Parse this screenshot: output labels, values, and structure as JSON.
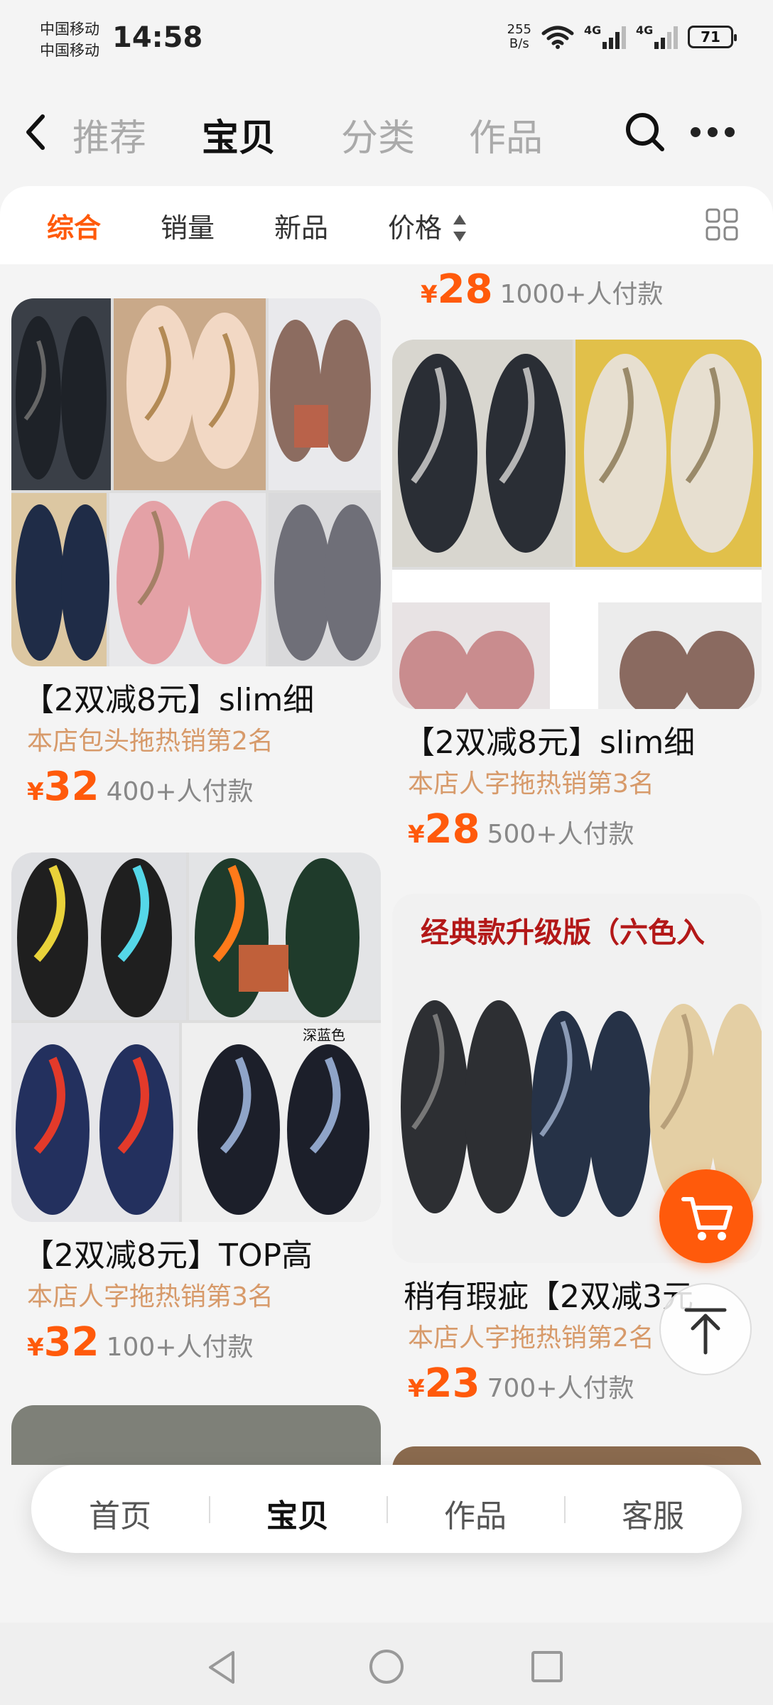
{
  "status_bar": {
    "carrier_1": "中国移动",
    "carrier_2": "中国移动",
    "time": "14:58",
    "net_speed_value": "255",
    "net_speed_unit": "B/s",
    "signal_1_label": "4G",
    "signal_2_label": "4G",
    "battery": "71"
  },
  "header": {
    "tabs": [
      "推荐",
      "宝贝",
      "分类",
      "作品"
    ],
    "active_tab": "宝贝"
  },
  "filters": {
    "items": [
      "综合",
      "销量",
      "新品",
      "价格"
    ],
    "active": "综合",
    "accent_color": "#ff5a0b"
  },
  "top_partial": {
    "right_price": "28",
    "right_sold": "1000+人付款"
  },
  "products": [
    {
      "title": "【2双减8元】slim细",
      "rank": "本店包头拖热销第2名",
      "price": "32",
      "sold": "400+人付款"
    },
    {
      "title": "【2双减8元】slim细",
      "rank": "本店人字拖热销第3名",
      "price": "28",
      "sold": "500+人付款"
    },
    {
      "title": "【2双减8元】TOP高",
      "rank": "本店人字拖热销第3名",
      "price": "32",
      "sold": "100+人付款"
    },
    {
      "title": "稍有瑕疵【2双减3元",
      "rank": "本店人字拖热销第2名",
      "price": "23",
      "sold": "700+人付款",
      "image_banner": "经典款升级版（六色入"
    }
  ],
  "thumb_text": {
    "label_dark_blue": "深蓝色"
  },
  "currency_symbol": "¥",
  "bottom_nav": {
    "items": [
      "首页",
      "宝贝",
      "作品",
      "客服"
    ],
    "active": "宝贝"
  },
  "icons": {
    "back": "chevron-left-icon",
    "search": "search-icon",
    "more": "more-dots-icon",
    "grid": "grid-view-icon",
    "cart": "cart-icon",
    "to_top": "arrow-up-icon"
  }
}
